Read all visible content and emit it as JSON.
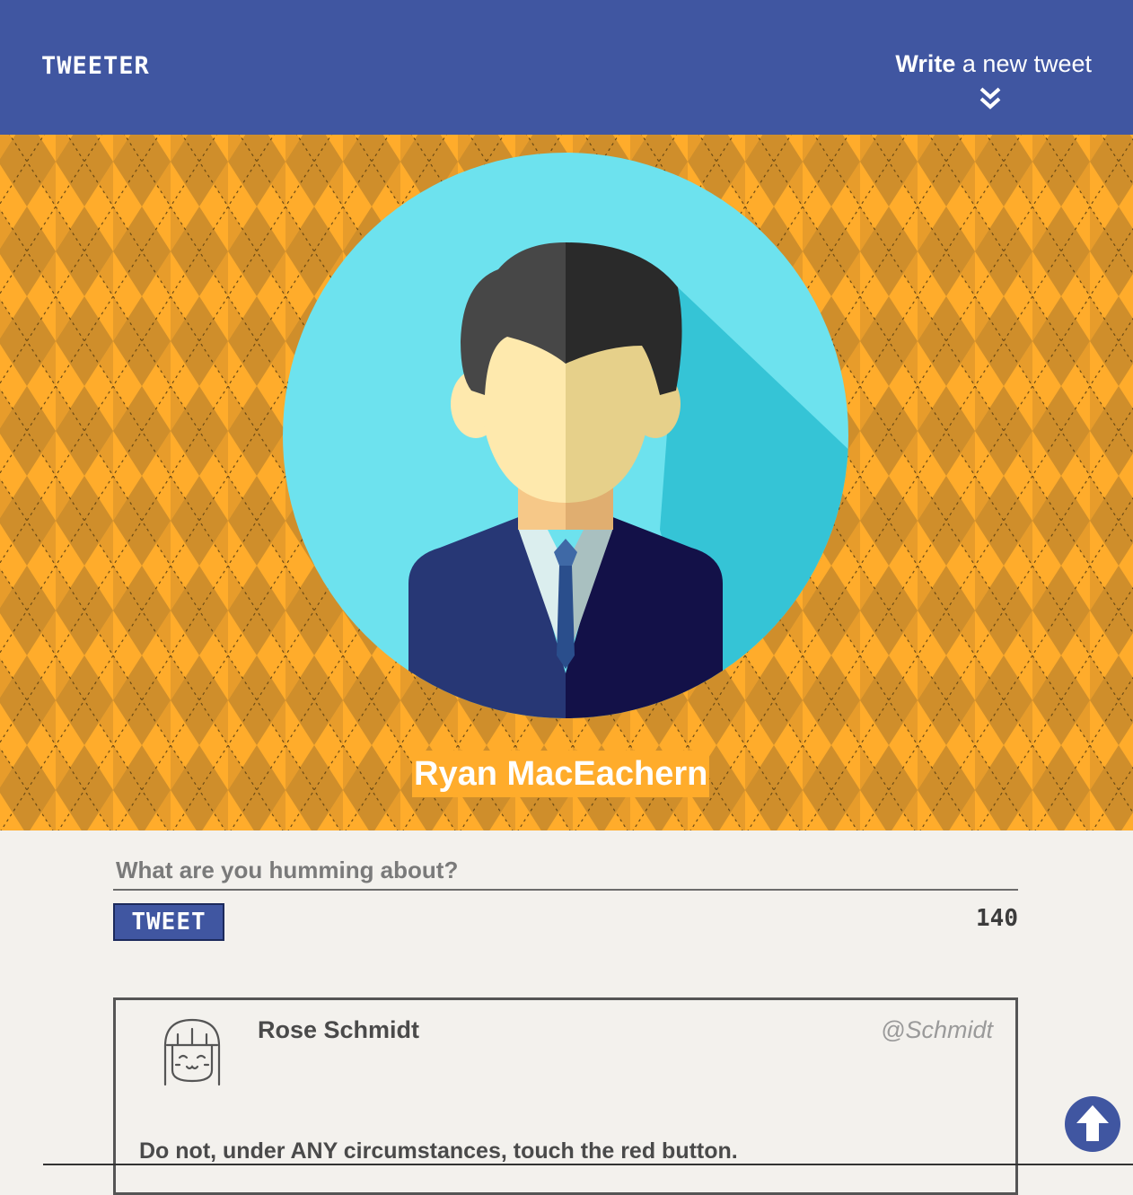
{
  "header": {
    "logo": "TWEETER",
    "compose_link_bold": "Write",
    "compose_link_rest": " a new tweet",
    "chevron_icon": "double-chevron-down-icon"
  },
  "profile": {
    "name": "Ryan MacEachern",
    "avatar_icon": "businessman-avatar-icon"
  },
  "compose": {
    "placeholder": "What are you humming about?",
    "value": "",
    "tweet_button": "TWEET",
    "char_count": "140"
  },
  "tweets": [
    {
      "name": "Rose Schmidt",
      "handle": "@Schmidt",
      "text": "Do not, under ANY circumstances, touch the red button.",
      "avatar_icon": "girl-face-avatar-icon"
    }
  ],
  "scroll_top_icon": "arrow-up-icon",
  "colors": {
    "header": "#4056a1",
    "hero": "#ffac2b",
    "background": "#f3f1ed"
  }
}
